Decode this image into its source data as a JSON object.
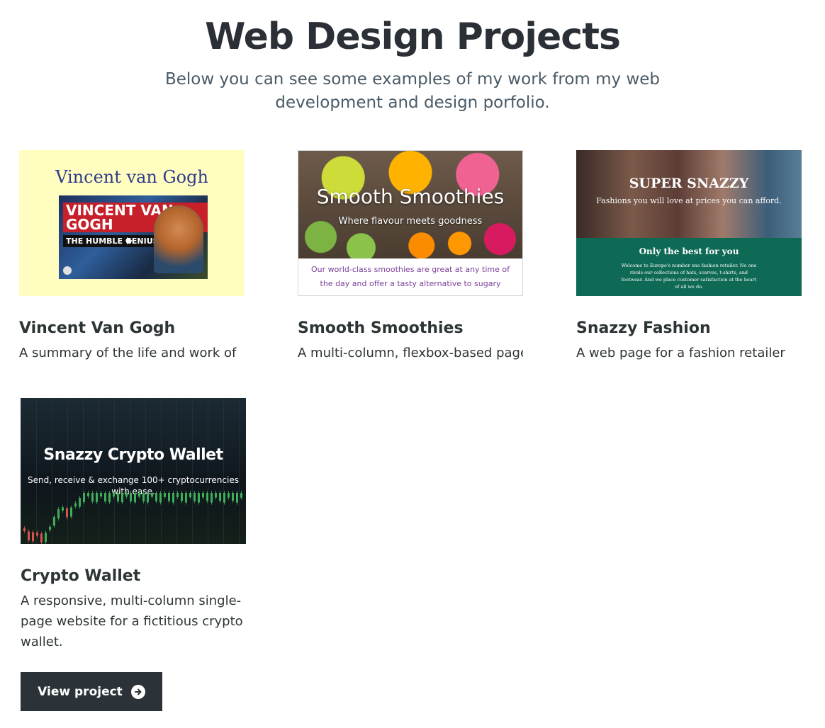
{
  "header": {
    "title": "Web Design Projects",
    "subtitle": "Below you can see some examples of my work from my web development and design porfolio."
  },
  "projects": [
    {
      "title": "Vincent Van Gogh",
      "description": "A summary of the life and work of",
      "thumbnail": {
        "heading": "Vincent van Gogh",
        "video_name": "VINCENT VAN GOGH",
        "video_subtitle": "THE HUMBLE GENIUS"
      }
    },
    {
      "title": "Smooth Smoothies",
      "description": "A multi-column, flexbox-based page",
      "thumbnail": {
        "heading": "Smooth Smoothies",
        "tagline": "Where flavour meets goodness",
        "body": "Our world-class smoothies are great at any time of the day and offer a tasty alternative to sugary"
      }
    },
    {
      "title": "Snazzy Fashion",
      "description": "A web page for a fashion retailer",
      "thumbnail": {
        "heading": "SUPER SNAZZY",
        "tagline": "Fashions you will love at prices you can afford.",
        "subheading": "Only the best for you",
        "body": "Welcome to Europe's number one fashion retailer. No one rivals our collections of hats, scarves, t-shirts, and footwear. And we place customer satisfaction at the heart of all we do."
      }
    },
    {
      "title": "Crypto Wallet",
      "description": "A responsive, multi-column single-page website for a fictitious crypto wallet.",
      "thumbnail": {
        "heading": "Snazzy Crypto Wallet",
        "tagline": "Send, receive & exchange 100+ cryptocurrencies with ease."
      }
    }
  ],
  "cta": {
    "label": "View project",
    "icon": "arrow-circle-right-icon"
  },
  "colors": {
    "text": "#2d3436",
    "button_bg": "#2b3338",
    "fashion_green": "#0f6a55",
    "vangogh_bg": "#fffec0"
  }
}
